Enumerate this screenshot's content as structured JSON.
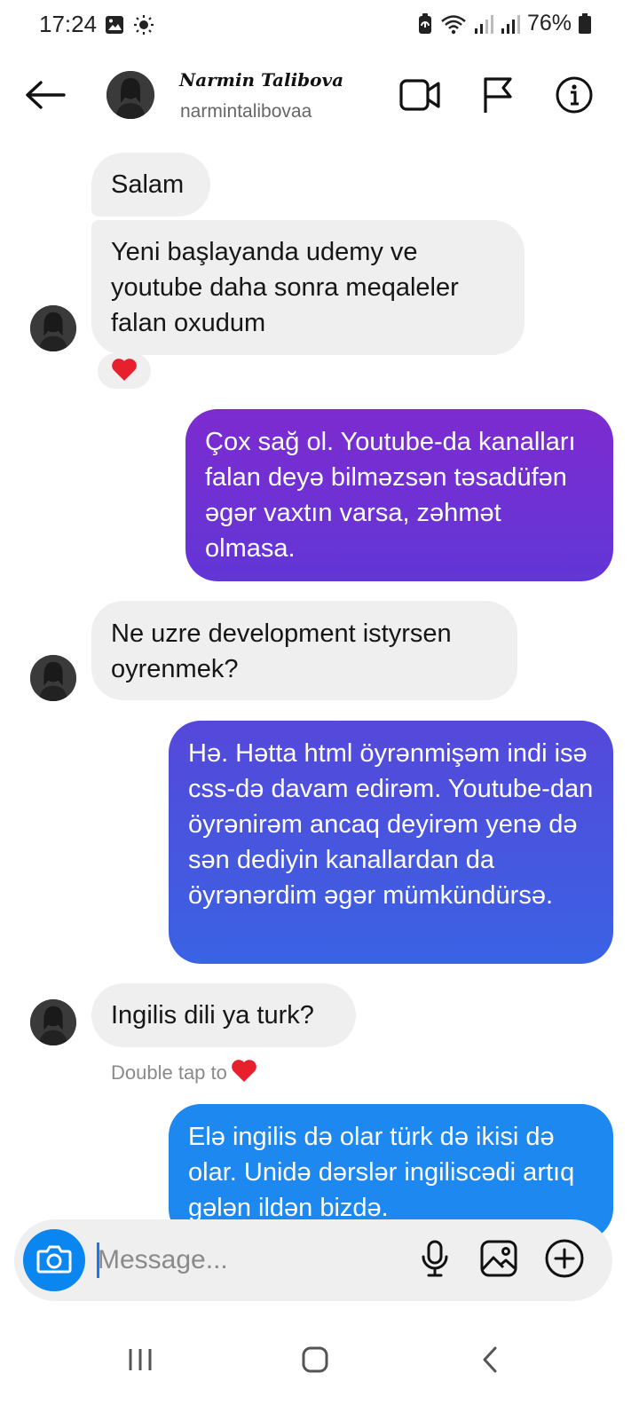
{
  "status_bar": {
    "time": "17:24",
    "battery": "76%",
    "icons": [
      "image-icon",
      "brightness-icon",
      "battery-saver-icon",
      "wifi-icon",
      "signal-icon",
      "signal-icon",
      "battery-icon"
    ]
  },
  "header": {
    "display_name": "Narmin Talibova",
    "username": "narmintalibovaa",
    "icons": [
      "back-arrow-icon",
      "video-call-icon",
      "flag-icon",
      "info-icon"
    ]
  },
  "messages": [
    {
      "from": "them",
      "text": "Salam"
    },
    {
      "from": "them",
      "text": "Yeni başlayanda udemy ve youtube daha sonra meqaleler falan oxudum",
      "reaction": "heart"
    },
    {
      "from": "me",
      "text": "Çox sağ ol. Youtube-da kanalları falan deyə bilməzsən təsadüfən əgər vaxtın varsa, zəhmət olmasa."
    },
    {
      "from": "them",
      "text": "Ne uzre development istyrsen oyrenmek?"
    },
    {
      "from": "me",
      "text": "Hə. Hətta html öyrənmişəm indi isə css-də davam edirəm. Youtube-dan öyrənirəm ancaq deyirəm yenə də sən dediyin kanallardan da öyrənərdim əgər mümkündürsə."
    },
    {
      "from": "them",
      "text": "Ingilis dili ya turk?"
    },
    {
      "from": "me",
      "text": "Elə ingilis də olar türk də ikisi də olar. Unidə dərslər ingiliscədi artıq gələn ildən bizdə."
    }
  ],
  "hint": {
    "text": "Double tap to",
    "icon": "heart-icon"
  },
  "composer": {
    "placeholder": "Message...",
    "icons": [
      "camera-icon",
      "microphone-icon",
      "gallery-icon",
      "add-icon"
    ]
  },
  "colors": {
    "received_bubble": "#efefef",
    "sent_gradient_top": "#7a2fd0",
    "sent_gradient_mid": "#4a58e0",
    "sent_gradient_bottom": "#1d88f0",
    "camera_button": "#0a86f0",
    "heart": "#e8202e"
  }
}
